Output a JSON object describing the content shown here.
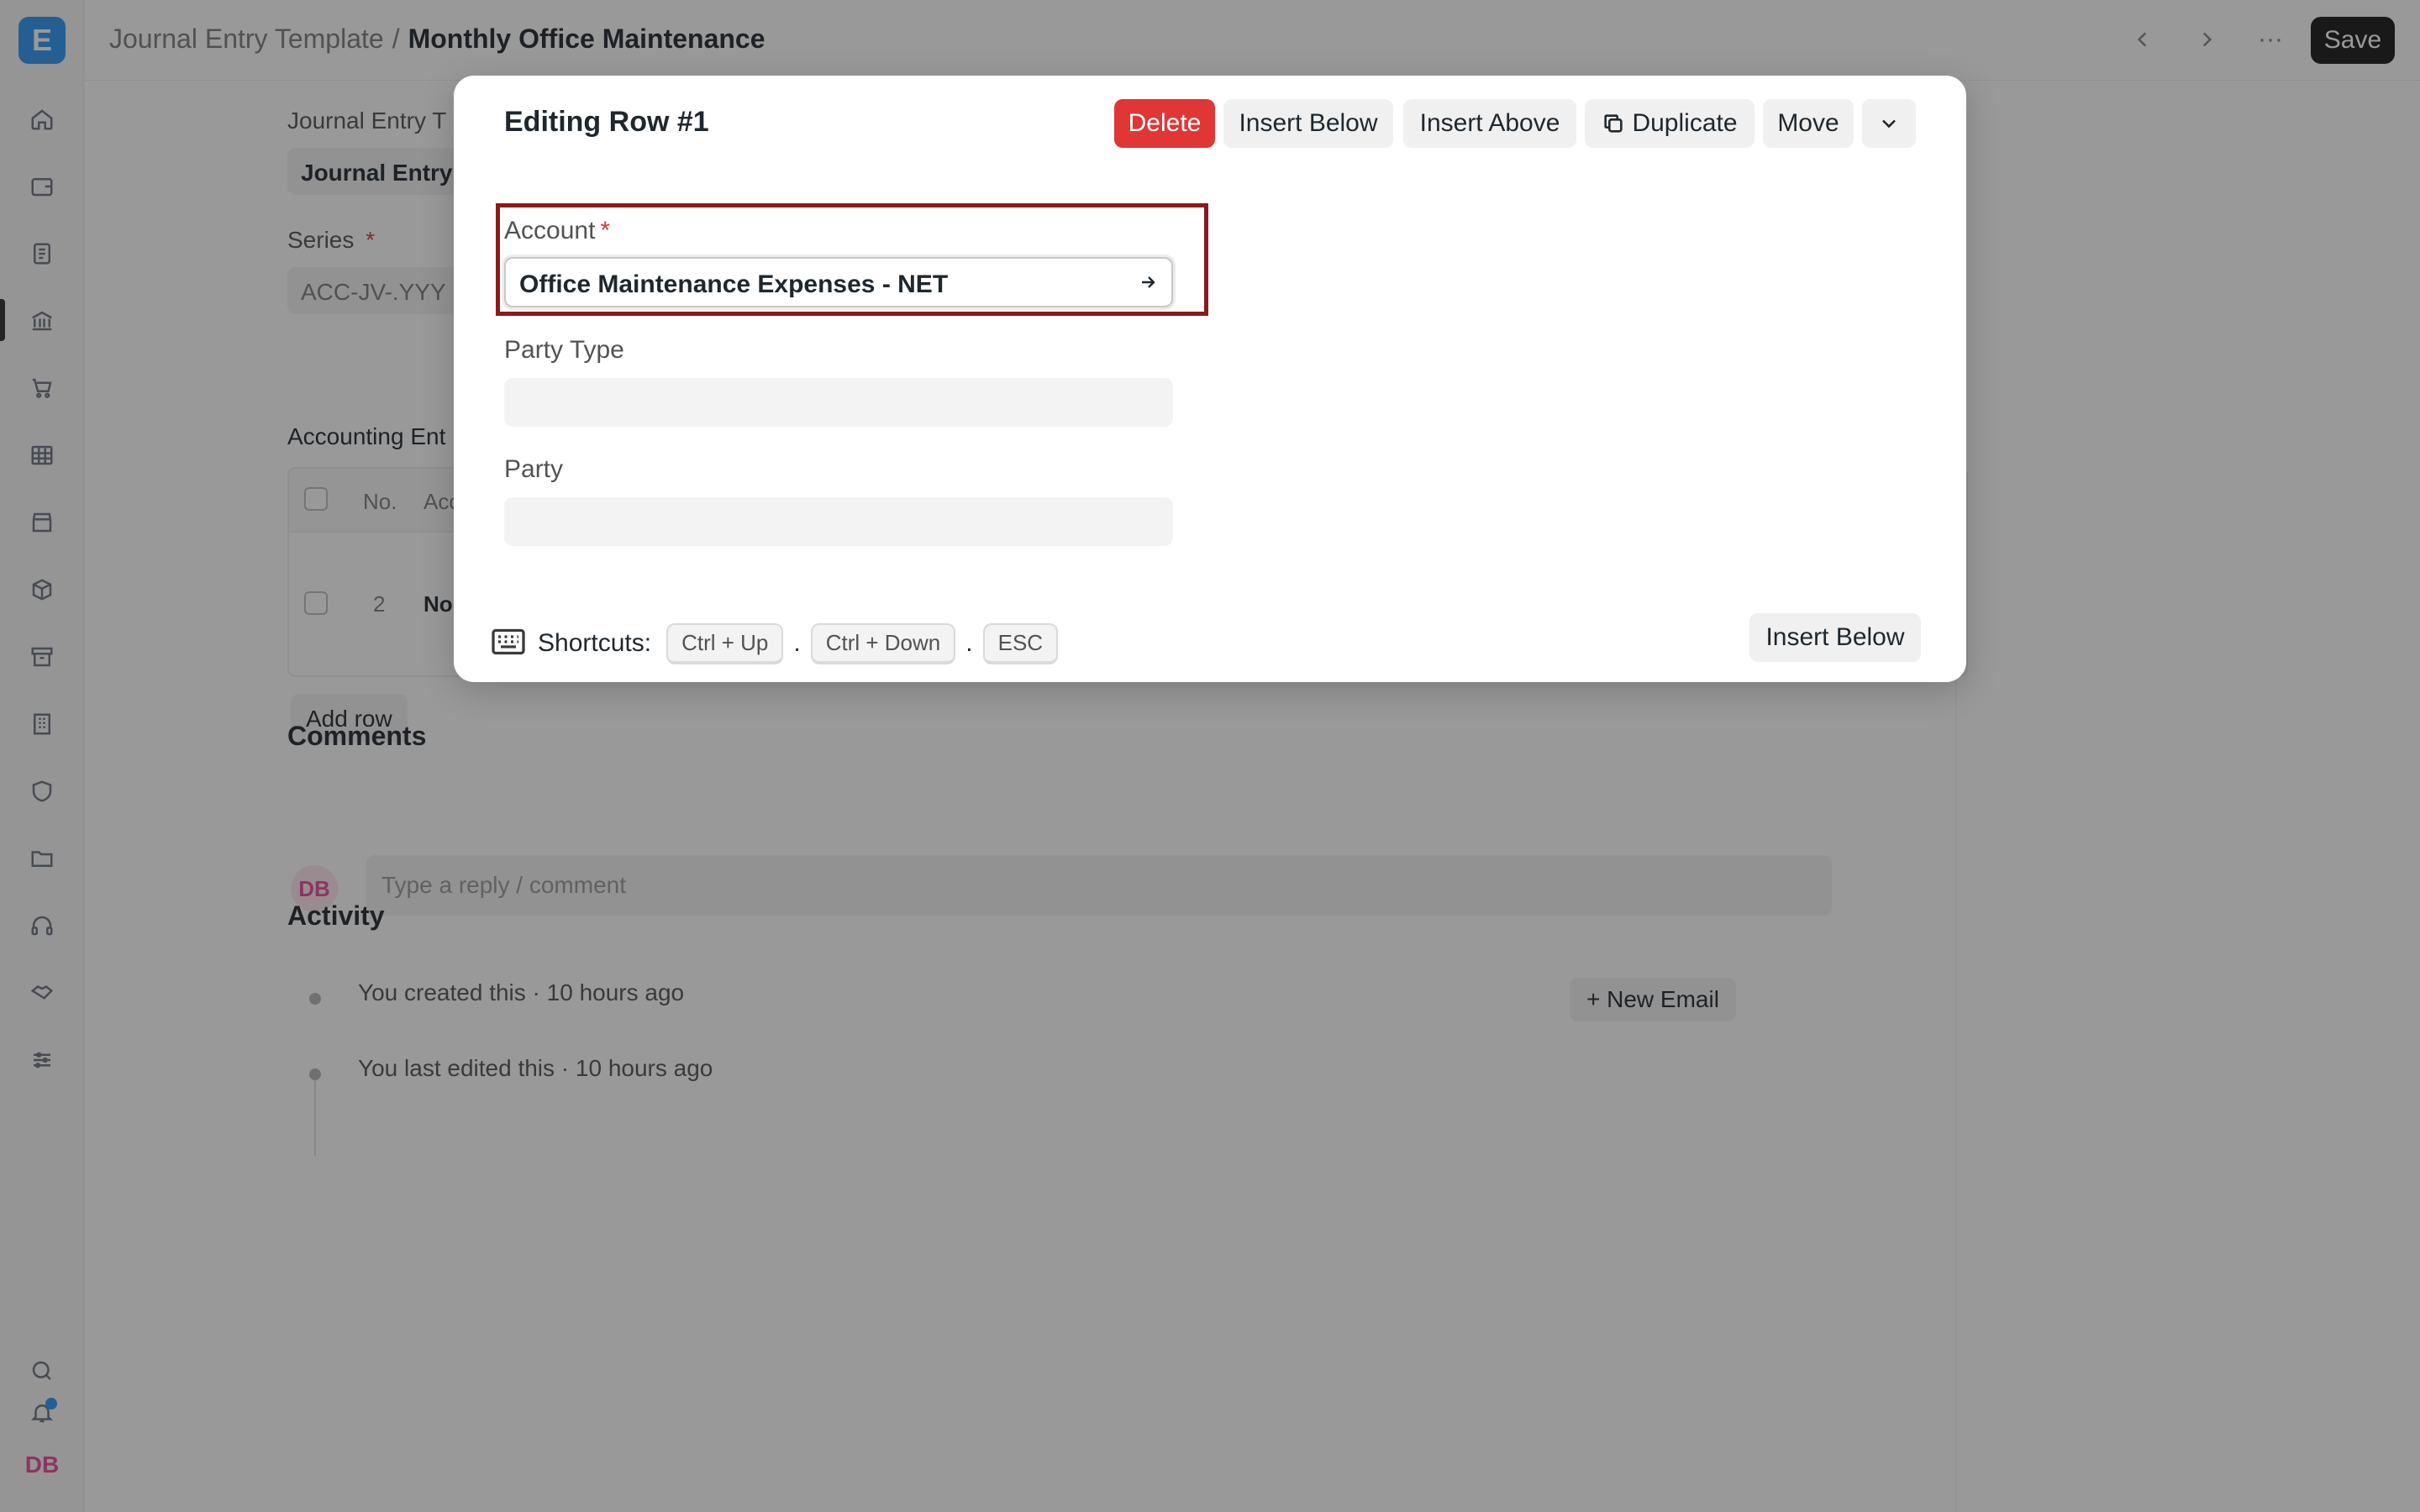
{
  "app": {
    "logo_letter": "E"
  },
  "breadcrumb": {
    "parent": "Journal Entry Template",
    "separator": "/",
    "current": "Monthly Office Maintenance"
  },
  "toolbar": {
    "save_label": "Save",
    "more_label": "···"
  },
  "form": {
    "template_label": "Journal Entry T",
    "template_value": "Journal Entry",
    "series_label": "Series",
    "series_required": "*",
    "series_value": "ACC-JV-.YYY",
    "accounting_title": "Accounting Ent",
    "grid_headers": {
      "no": "No.",
      "account": "Acc"
    },
    "grid_rows": [
      {
        "no": "2",
        "account": "No"
      }
    ],
    "add_row_label": "Add row"
  },
  "comments": {
    "title": "Comments",
    "avatar": "DB",
    "placeholder": "Type a reply / comment"
  },
  "activity": {
    "title": "Activity",
    "new_email_label": "+ New Email",
    "items": [
      {
        "text": "You created this · 10 hours ago"
      },
      {
        "text": "You last edited this · 10 hours ago"
      }
    ]
  },
  "sidebar": {
    "user_initials": "DB"
  },
  "dialog": {
    "title": "Editing Row #1",
    "buttons": {
      "delete": "Delete",
      "insert_below": "Insert Below",
      "insert_above": "Insert Above",
      "duplicate": "Duplicate",
      "move": "Move"
    },
    "fields": {
      "account_label": "Account",
      "account_required": "*",
      "account_value": "Office Maintenance Expenses - NET",
      "party_type_label": "Party Type",
      "party_type_value": "",
      "party_label": "Party",
      "party_value": ""
    },
    "shortcuts": {
      "label": "Shortcuts:",
      "keys": [
        "Ctrl + Up",
        "Ctrl + Down",
        "ESC"
      ],
      "separator": "."
    },
    "footer_insert_below": "Insert Below"
  },
  "colors": {
    "danger": "#e03636",
    "highlight_border": "#8b1a1a",
    "accent": "#2d95f0"
  }
}
